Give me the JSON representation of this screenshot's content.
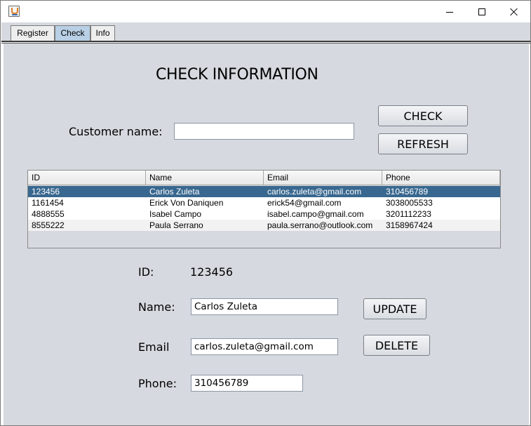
{
  "window": {
    "title": ""
  },
  "tabs": [
    {
      "label": "Register",
      "active": false
    },
    {
      "label": "Check",
      "active": true
    },
    {
      "label": "Info",
      "active": false
    }
  ],
  "form": {
    "title": "CHECK INFORMATION",
    "customer_name_label": "Customer name:",
    "customer_name_value": "",
    "check_button": "CHECK",
    "refresh_button": "REFRESH"
  },
  "table": {
    "columns": [
      "ID",
      "Name",
      "Email",
      "Phone"
    ],
    "rows": [
      {
        "id": "123456",
        "name": "Carlos Zuleta",
        "email": "carlos.zuleta@gmail.com",
        "phone": "310456789",
        "selected": true
      },
      {
        "id": "1161454",
        "name": "Erick Von Daniquen",
        "email": "erick54@gmail.com",
        "phone": "3038005533",
        "selected": false
      },
      {
        "id": "4888555",
        "name": "Isabel Campo",
        "email": "isabel.campo@gmail.com",
        "phone": "3201112233",
        "selected": false
      },
      {
        "id": "8555222",
        "name": "Paula Serrano",
        "email": "paula.serrano@outlook.com",
        "phone": "3158967424",
        "selected": false
      }
    ]
  },
  "details": {
    "id_label": "ID:",
    "id_value": "123456",
    "name_label": "Name:",
    "name_value": "Carlos Zuleta",
    "email_label": "Email",
    "email_value": "carlos.zuleta@gmail.com",
    "phone_label": "Phone:",
    "phone_value": "310456789",
    "update_button": "UPDATE",
    "delete_button": "DELETE"
  },
  "colors": {
    "panel_bg": "#d6d9df",
    "selected_row": "#38678f",
    "active_tab": "#b8cfe5"
  },
  "icons": {
    "app": "java-coffee-icon",
    "minimize": "minimize-icon",
    "maximize": "maximize-icon",
    "close": "close-icon"
  }
}
